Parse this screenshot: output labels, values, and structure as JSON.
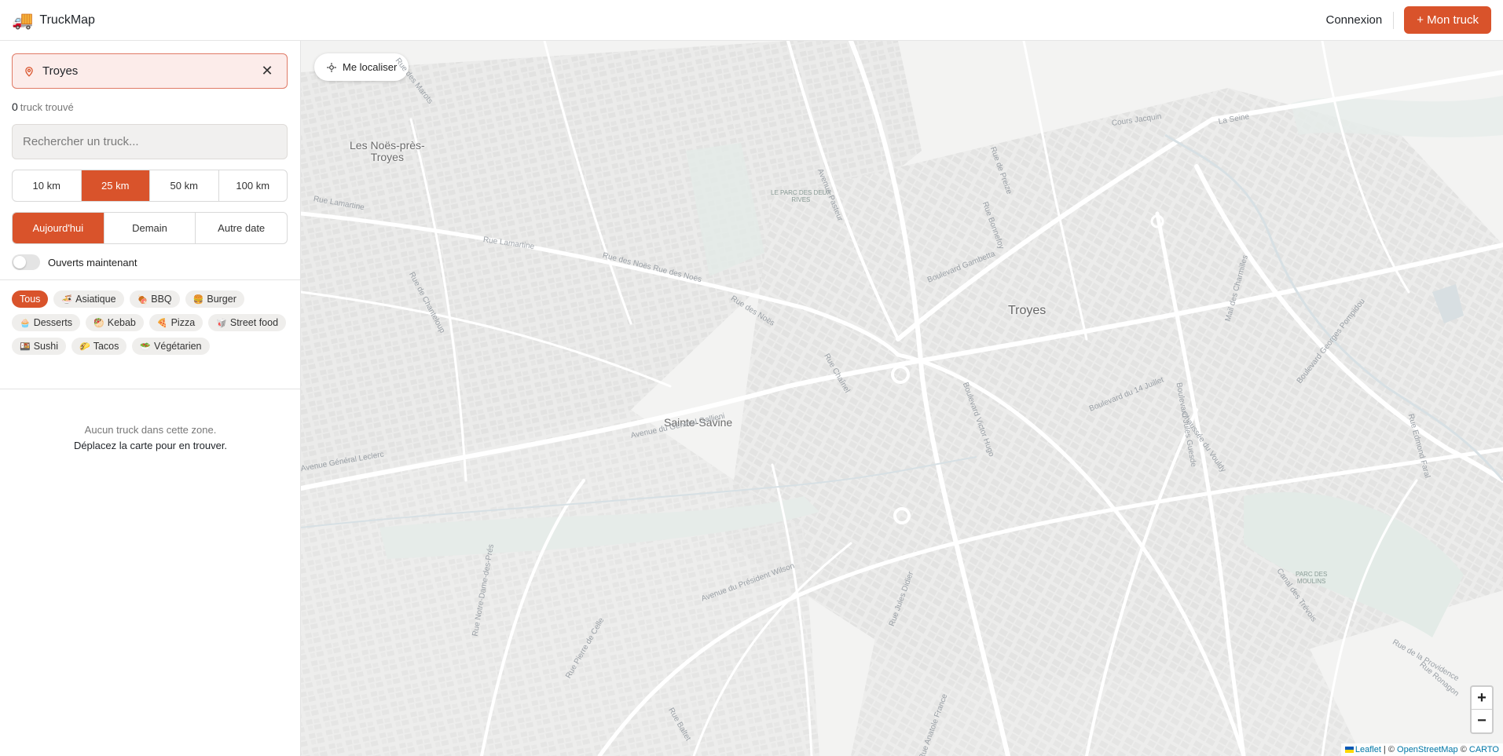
{
  "header": {
    "brand_icon": "🚚",
    "brand_name": "TruckMap",
    "login_label": "Connexion",
    "cta_label": "+ Mon truck"
  },
  "sidebar": {
    "location_value": "Troyes",
    "count_number": "0",
    "count_text": "truck trouvé",
    "search_placeholder": "Rechercher un truck...",
    "distance_options": [
      {
        "label": "10 km",
        "active": false
      },
      {
        "label": "25 km",
        "active": true
      },
      {
        "label": "50 km",
        "active": false
      },
      {
        "label": "100 km",
        "active": false
      }
    ],
    "day_options": [
      {
        "label": "Aujourd'hui",
        "active": true
      },
      {
        "label": "Demain",
        "active": false
      },
      {
        "label": "Autre date",
        "active": false
      }
    ],
    "open_now_label": "Ouverts maintenant",
    "open_now_on": false,
    "categories": [
      {
        "emoji": "",
        "label": "Tous",
        "active": true
      },
      {
        "emoji": "🍜",
        "label": "Asiatique",
        "active": false
      },
      {
        "emoji": "🍖",
        "label": "BBQ",
        "active": false
      },
      {
        "emoji": "🍔",
        "label": "Burger",
        "active": false
      },
      {
        "emoji": "🧁",
        "label": "Desserts",
        "active": false
      },
      {
        "emoji": "🥙",
        "label": "Kebab",
        "active": false
      },
      {
        "emoji": "🍕",
        "label": "Pizza",
        "active": false
      },
      {
        "emoji": "🥡",
        "label": "Street food",
        "active": false
      },
      {
        "emoji": "🍱",
        "label": "Sushi",
        "active": false
      },
      {
        "emoji": "🌮",
        "label": "Tacos",
        "active": false
      },
      {
        "emoji": "🥗",
        "label": "Végétarien",
        "active": false
      }
    ],
    "empty_line1": "Aucun truck dans cette zone.",
    "empty_line2": "Déplacez la carte pour en trouver."
  },
  "map": {
    "locate_label": "Me localiser",
    "places": {
      "noes": "Les Noës-près-\nTroyes",
      "troyes": "Troyes",
      "sainte_savine": "Sainte-Savine",
      "parc_deux_rives": "LE PARC DES DEUX\nRIVES",
      "parc_moulins": "PARC DES\nMOULINS"
    },
    "streets": [
      "Rue des Marots",
      "Rue Lamartine",
      "Rue Lamartine",
      "Rue des Noës Rue des Noës",
      "Rue des Noës",
      "Avenue Pasteur",
      "Boulevard Gambetta",
      "Rue de Preize",
      "Cours Jacquin",
      "La Seine",
      "Avenue du Général Gallieni",
      "Boulevard Victor Hugo",
      "Boulevard du 14 Juillet",
      "Boulevard Jules Guesde",
      "Boulevard Georges Pompidou",
      "Avenue du Président Wilson",
      "Rue Jules Didier",
      "Rue Notre-Dame-des-Prés",
      "Rue de Chanteloup",
      "Rue Pierre de Celle",
      "Rue Baltet",
      "Rue Chaînel",
      "Mail des Charmilles",
      "Rue Edmond Faral",
      "Canal des Trévois",
      "Avenue Général Leclerc",
      "Rue Bonnefoy",
      "Rue Ronagon",
      "Rue de la Providence",
      "Rue Anatole France",
      "Chaussée du Vouldy"
    ],
    "zoom_in": "+",
    "zoom_out": "−",
    "attribution": {
      "leaflet": "Leaflet",
      "sep1": " | © ",
      "osm": "OpenStreetMap",
      "sep2": " © ",
      "carto": "CARTO"
    }
  },
  "colors": {
    "accent": "#d9532b",
    "map_bg": "#f4f4f3"
  }
}
